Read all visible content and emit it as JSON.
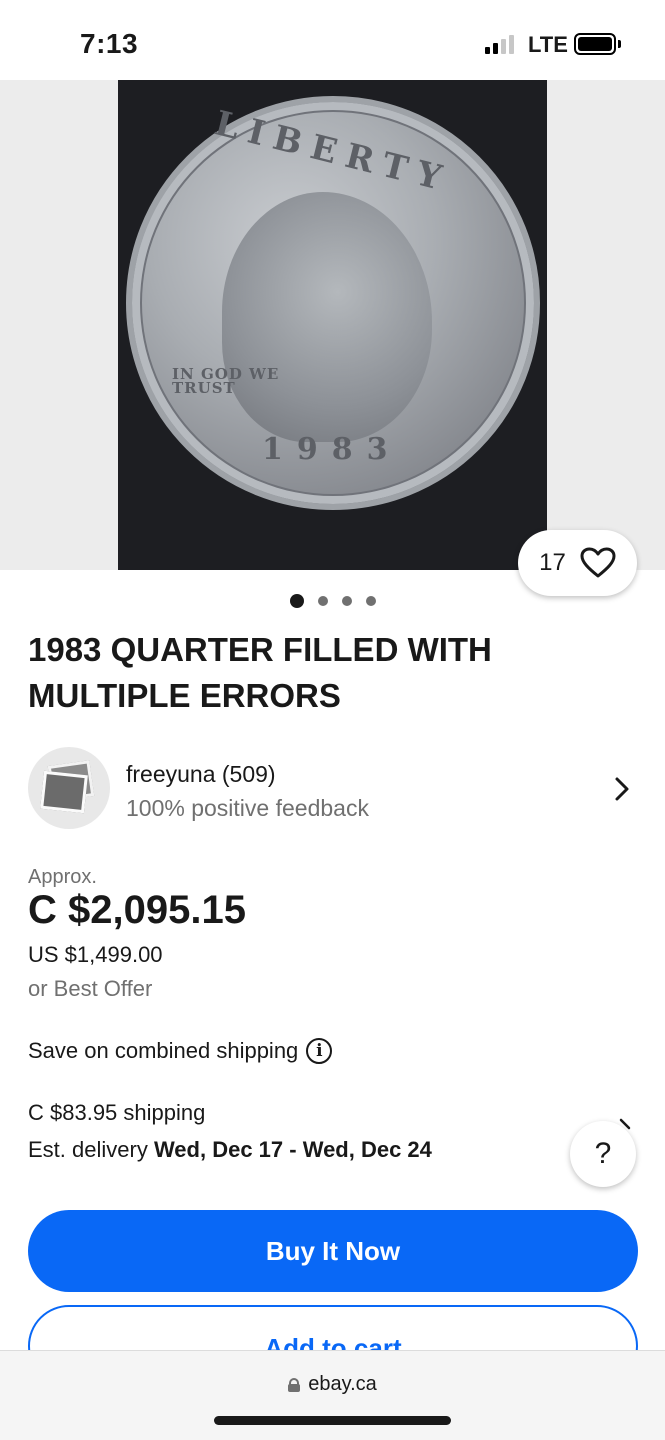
{
  "status_bar": {
    "time": "7:13",
    "network": "LTE"
  },
  "gallery": {
    "favorites_count": "17",
    "image_count": 4,
    "active_index": 0
  },
  "coin_photo": {
    "top_word": "LIBERTY",
    "year": "1983",
    "motto_line1": "IN GOD WE",
    "motto_line2": "TRUST"
  },
  "listing": {
    "title": "1983 QUARTER FILLED WITH MULTIPLE ERRORS"
  },
  "seller": {
    "name": "freeyuna (509)",
    "feedback": "100% positive feedback"
  },
  "price": {
    "approx_label": "Approx.",
    "main": "C $2,095.15",
    "usd": "US $1,499.00",
    "best_offer": "or Best Offer"
  },
  "shipping": {
    "combined_label": "Save on combined shipping",
    "cost": "C $83.95 shipping",
    "delivery_prefix": "Est. delivery ",
    "delivery_dates": "Wed, Dec 17 - Wed, Dec 24"
  },
  "help": {
    "label": "?"
  },
  "actions": {
    "buy_now": "Buy It Now",
    "add_to_cart": "Add to cart"
  },
  "browser": {
    "domain": "ebay.ca"
  },
  "colors": {
    "primary_blue": "#0968f6",
    "text_dark": "#191919",
    "text_gray": "#707070"
  }
}
